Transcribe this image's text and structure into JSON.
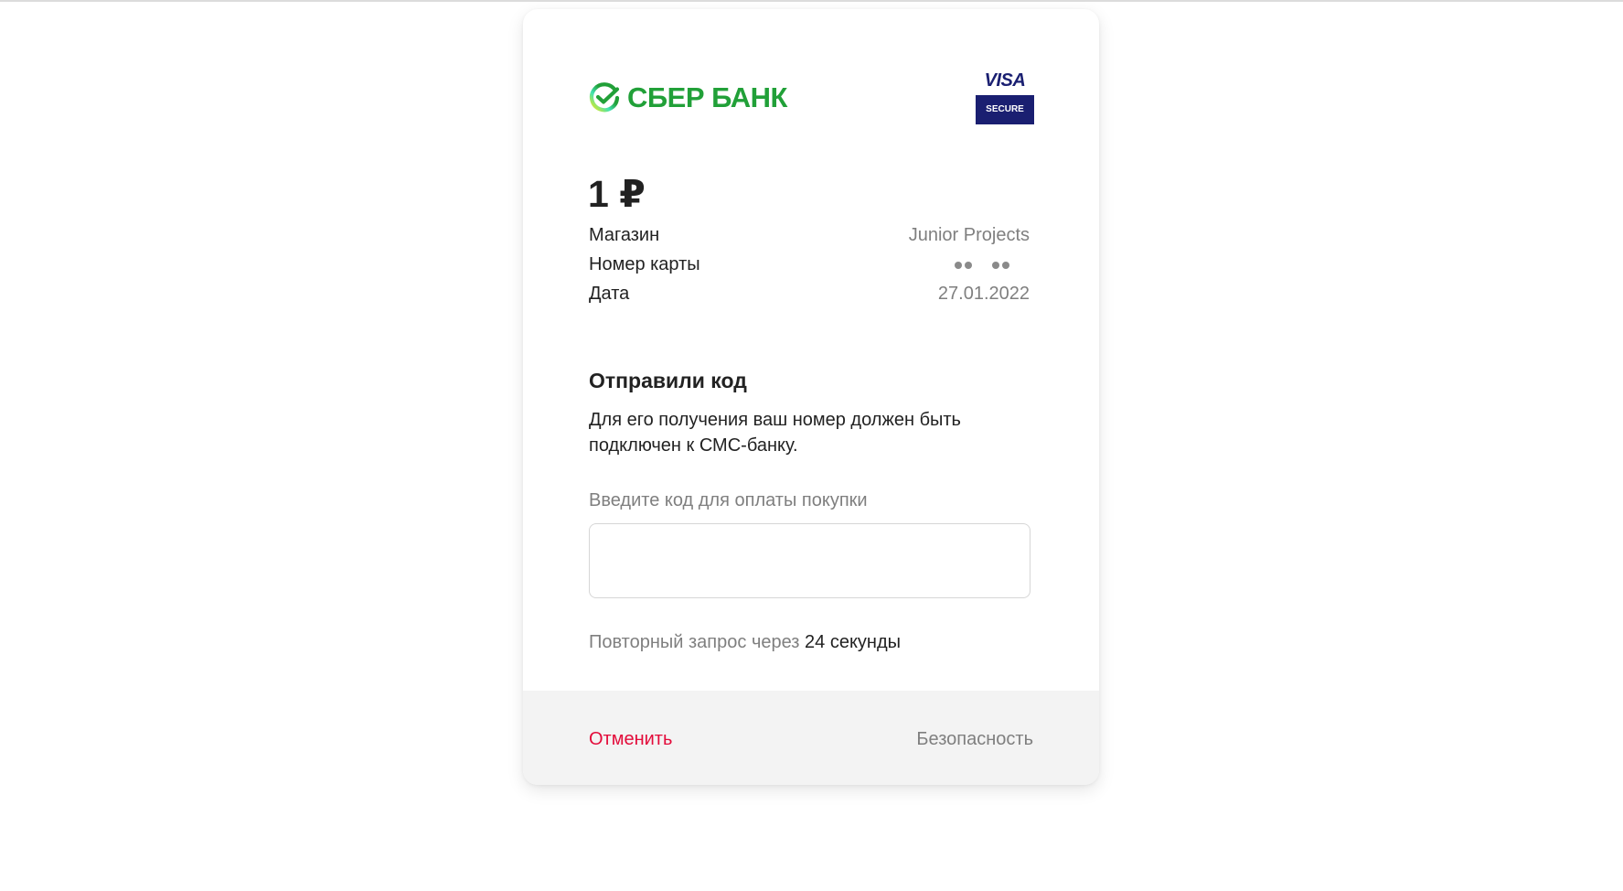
{
  "brand": {
    "bank_name": "СБЕР БАНК",
    "bank_color": "#21a038",
    "visa_word": "VISA",
    "visa_secure": "SECURE",
    "visa_color": "#1a1f71"
  },
  "payment": {
    "amount": "1 ₽"
  },
  "details": [
    {
      "label": "Магазин",
      "value": "Junior Projects"
    },
    {
      "label": "Номер карты",
      "value": "•• ••"
    },
    {
      "label": "Дата",
      "value": "27.01.2022"
    }
  ],
  "otp": {
    "heading": "Отправили код",
    "description": "Для его получения ваш номер должен быть подключен к СМС-банку.",
    "input_label": "Введите код для оплаты покупки",
    "input_value": "",
    "resend_prefix": "Повторный запрос через",
    "resend_timer": "24 секунды"
  },
  "footer": {
    "cancel_label": "Отменить",
    "cancel_color": "#e30b3a",
    "security_label": "Безопасность"
  },
  "icons": {
    "sber_logo": "sber-checkmark-logo-icon",
    "annotation_arrow": "arrow-icon"
  }
}
